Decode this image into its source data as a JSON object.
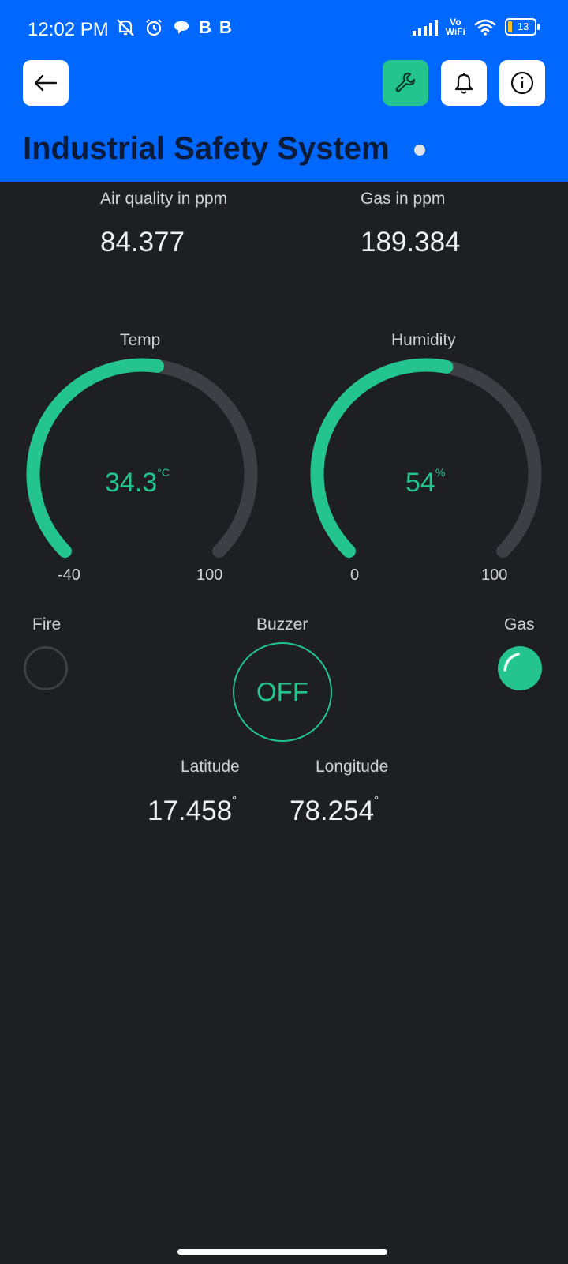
{
  "status_bar": {
    "time": "12:02 PM",
    "b1": "B",
    "b2": "B",
    "vowifi_top": "Vo",
    "vowifi_bottom": "WiFi",
    "battery": "13"
  },
  "header": {
    "title": "Industrial Safety System"
  },
  "widgets": {
    "air_quality": {
      "label": "Air quality in ppm",
      "value": "84.377"
    },
    "gas_ppm": {
      "label": "Gas in ppm",
      "value": "189.384"
    },
    "temp": {
      "label": "Temp",
      "value": "34.3",
      "unit": "°C",
      "min": "-40",
      "max": "100",
      "fraction": 0.53
    },
    "humidity": {
      "label": "Humidity",
      "value": "54",
      "unit": "%",
      "min": "0",
      "max": "100",
      "fraction": 0.54
    },
    "fire": {
      "label": "Fire",
      "state": "off"
    },
    "buzzer": {
      "label": "Buzzer",
      "state_text": "OFF"
    },
    "gas_led": {
      "label": "Gas",
      "state": "on"
    },
    "latitude": {
      "label": "Latitude",
      "value": "17.458",
      "unit": "°"
    },
    "longitude": {
      "label": "Longitude",
      "value": "78.254",
      "unit": "°"
    }
  },
  "colors": {
    "accent": "#23c48e",
    "header_bg": "#0067ff",
    "background": "#1d1f23",
    "track": "#3d3f44"
  },
  "icons": [
    "back-arrow-icon",
    "wrench-icon",
    "bell-icon",
    "info-icon"
  ]
}
